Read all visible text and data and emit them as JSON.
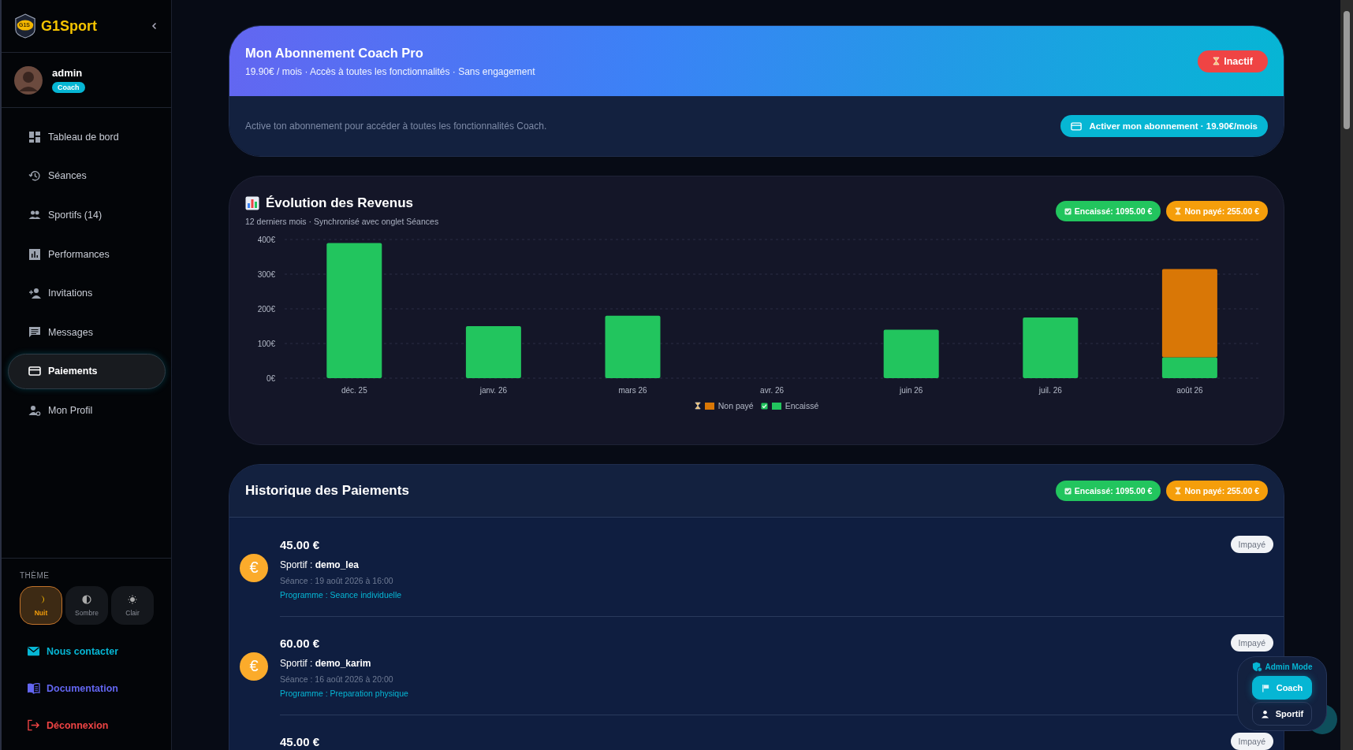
{
  "sidebar": {
    "logo_badge": "G1S",
    "brand": "G1Sport",
    "user": {
      "name": "admin",
      "role": "Coach"
    },
    "nav": [
      {
        "label": "Tableau de bord",
        "kind": "dashboard",
        "selected": false
      },
      {
        "label": "Séances",
        "kind": "history",
        "selected": false
      },
      {
        "label": "Sportifs (14)",
        "kind": "people",
        "selected": false
      },
      {
        "label": "Performances",
        "kind": "stats",
        "selected": false
      },
      {
        "label": "Invitations",
        "kind": "invite",
        "selected": false
      },
      {
        "label": "Messages",
        "kind": "message",
        "selected": false
      },
      {
        "label": "Paiements",
        "kind": "card",
        "selected": true
      },
      {
        "label": "Mon Profil",
        "kind": "profile",
        "selected": false
      }
    ],
    "theme": {
      "title": "THÈME",
      "options": [
        {
          "label": "Nuit",
          "kind": "moon",
          "selected": true
        },
        {
          "label": "Sombre",
          "kind": "contrast",
          "selected": false
        },
        {
          "label": "Clair",
          "kind": "sun",
          "selected": false
        }
      ]
    },
    "links": [
      {
        "label": "Nous contacter",
        "kind": "mail",
        "color": "#06b6d4"
      },
      {
        "label": "Documentation",
        "kind": "book",
        "color": "#6366f1"
      },
      {
        "label": "Déconnexion",
        "kind": "logout",
        "color": "#ef4444"
      }
    ]
  },
  "subscription": {
    "title": "Mon Abonnement Coach Pro",
    "subtitle": "19.90€ / mois · Accès à toutes les fonctionnalités · Sans engagement",
    "status": "Inactif",
    "message": "Active ton abonnement pour accéder à toutes les fonctionnalités Coach.",
    "button": "Activer mon abonnement · 19.90€/mois"
  },
  "revenue": {
    "title": "Évolution des Revenus",
    "subtitle": "12 derniers mois · Synchronisé avec onglet Séances",
    "badges": [
      {
        "kind": "paid",
        "label": "Encaissé: 1095.00 €"
      },
      {
        "kind": "unpaid",
        "label": "Non payé: 255.00 €"
      }
    ],
    "chart_data": {
      "type": "bar",
      "stacked": true,
      "grid": true,
      "legend": "bottom",
      "categories": [
        "déc. 25",
        "janv. 26",
        "mars 26",
        "avr. 26",
        "juin 26",
        "juil. 26",
        "août 26"
      ],
      "series": [
        {
          "name": "Non payé",
          "color": "#d97706",
          "values": [
            0,
            0,
            0,
            0,
            0,
            0,
            255
          ]
        },
        {
          "name": "Encaissé",
          "color": "#22c55e",
          "values": [
            390,
            150,
            180,
            0,
            140,
            175,
            60
          ]
        }
      ],
      "ylim": [
        0,
        400
      ],
      "yticks": [
        {
          "value": 0,
          "label": "0€"
        },
        {
          "value": 100,
          "label": "100€"
        },
        {
          "value": 200,
          "label": "200€"
        },
        {
          "value": 300,
          "label": "300€"
        },
        {
          "value": 400,
          "label": "400€"
        }
      ]
    }
  },
  "history": {
    "title": "Historique des Paiements",
    "badges": [
      {
        "kind": "paid",
        "label": "Encaissé: 1095.00 €"
      },
      {
        "kind": "unpaid",
        "label": "Non payé: 255.00 €"
      }
    ],
    "payments": [
      {
        "symbol": "€",
        "amount": "45.00 €",
        "athlete": "Sportif : **demo_lea**",
        "session": "Séance : 19 août 2026 à 16:00",
        "program": "Programme : Seance individuelle",
        "status": "Impayé"
      },
      {
        "symbol": "€",
        "amount": "60.00 €",
        "athlete": "Sportif : **demo_karim**",
        "session": "Séance : 16 août 2026 à 20:00",
        "program": "Programme : Preparation physique",
        "status": "Impayé"
      },
      {
        "amount": "45.00 €",
        "status": "Impayé"
      }
    ]
  },
  "mode_switch": {
    "title": "Admin Mode",
    "options": [
      {
        "label": "Coach",
        "kind": "flag",
        "selected": true
      },
      {
        "label": "Sportif",
        "kind": "person",
        "selected": false
      }
    ]
  }
}
